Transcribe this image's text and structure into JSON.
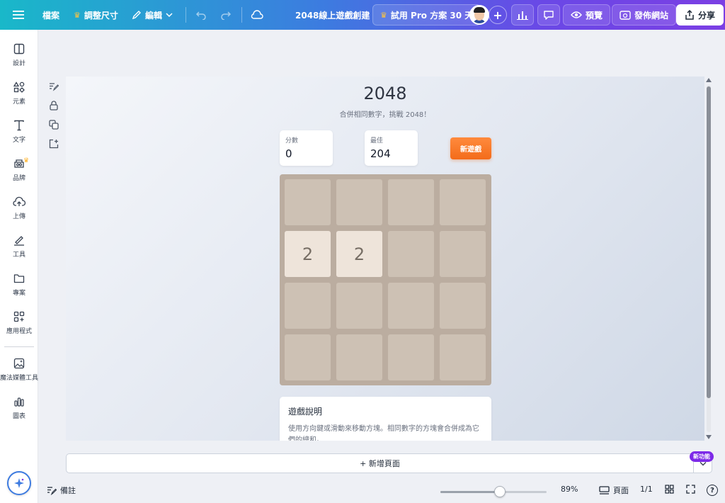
{
  "topbar": {
    "file": "檔案",
    "resize": "調整尺寸",
    "edit": "編輯",
    "doc_title": "2048線上遊戲創建",
    "trial": "試用 Pro 方案 30 天",
    "preview": "預覽",
    "publish": "發佈網站",
    "share": "分享"
  },
  "sidebar": {
    "items": [
      {
        "label": "設計"
      },
      {
        "label": "元素"
      },
      {
        "label": "文字"
      },
      {
        "label": "品牌"
      },
      {
        "label": "上傳"
      },
      {
        "label": "工具"
      },
      {
        "label": "專案"
      },
      {
        "label": "應用程式"
      },
      {
        "label": "魔法媒體工具"
      },
      {
        "label": "圖表"
      }
    ]
  },
  "game": {
    "title": "2048",
    "subtitle": "合併相同數字，挑戰 2048！",
    "score_label": "分數",
    "score": "0",
    "best_label": "最佳",
    "best": "204",
    "new_game": "新遊戲",
    "cells": [
      "",
      "",
      "",
      "",
      "2",
      "2",
      "",
      "",
      "",
      "",
      "",
      "",
      "",
      "",
      "",
      ""
    ],
    "instructions_title": "遊戲說明",
    "instructions_text": "使用方向鍵或滑動來移動方塊。相同數字的方塊會合併成為它們的總和。"
  },
  "add_page": {
    "label": "+ 新增頁面",
    "badge": "新功能"
  },
  "bottombar": {
    "notes": "備註",
    "zoom": "89%",
    "zoom_fraction": 0.56,
    "pages_label": "頁面",
    "page_count": "1/1",
    "help": "?"
  },
  "colors": {
    "accent": "#7d2ae8",
    "new_game": "#f36c1a",
    "board": "#bbada0",
    "tile_empty": "#cdc1b4",
    "tile_2": "#eee4da"
  }
}
